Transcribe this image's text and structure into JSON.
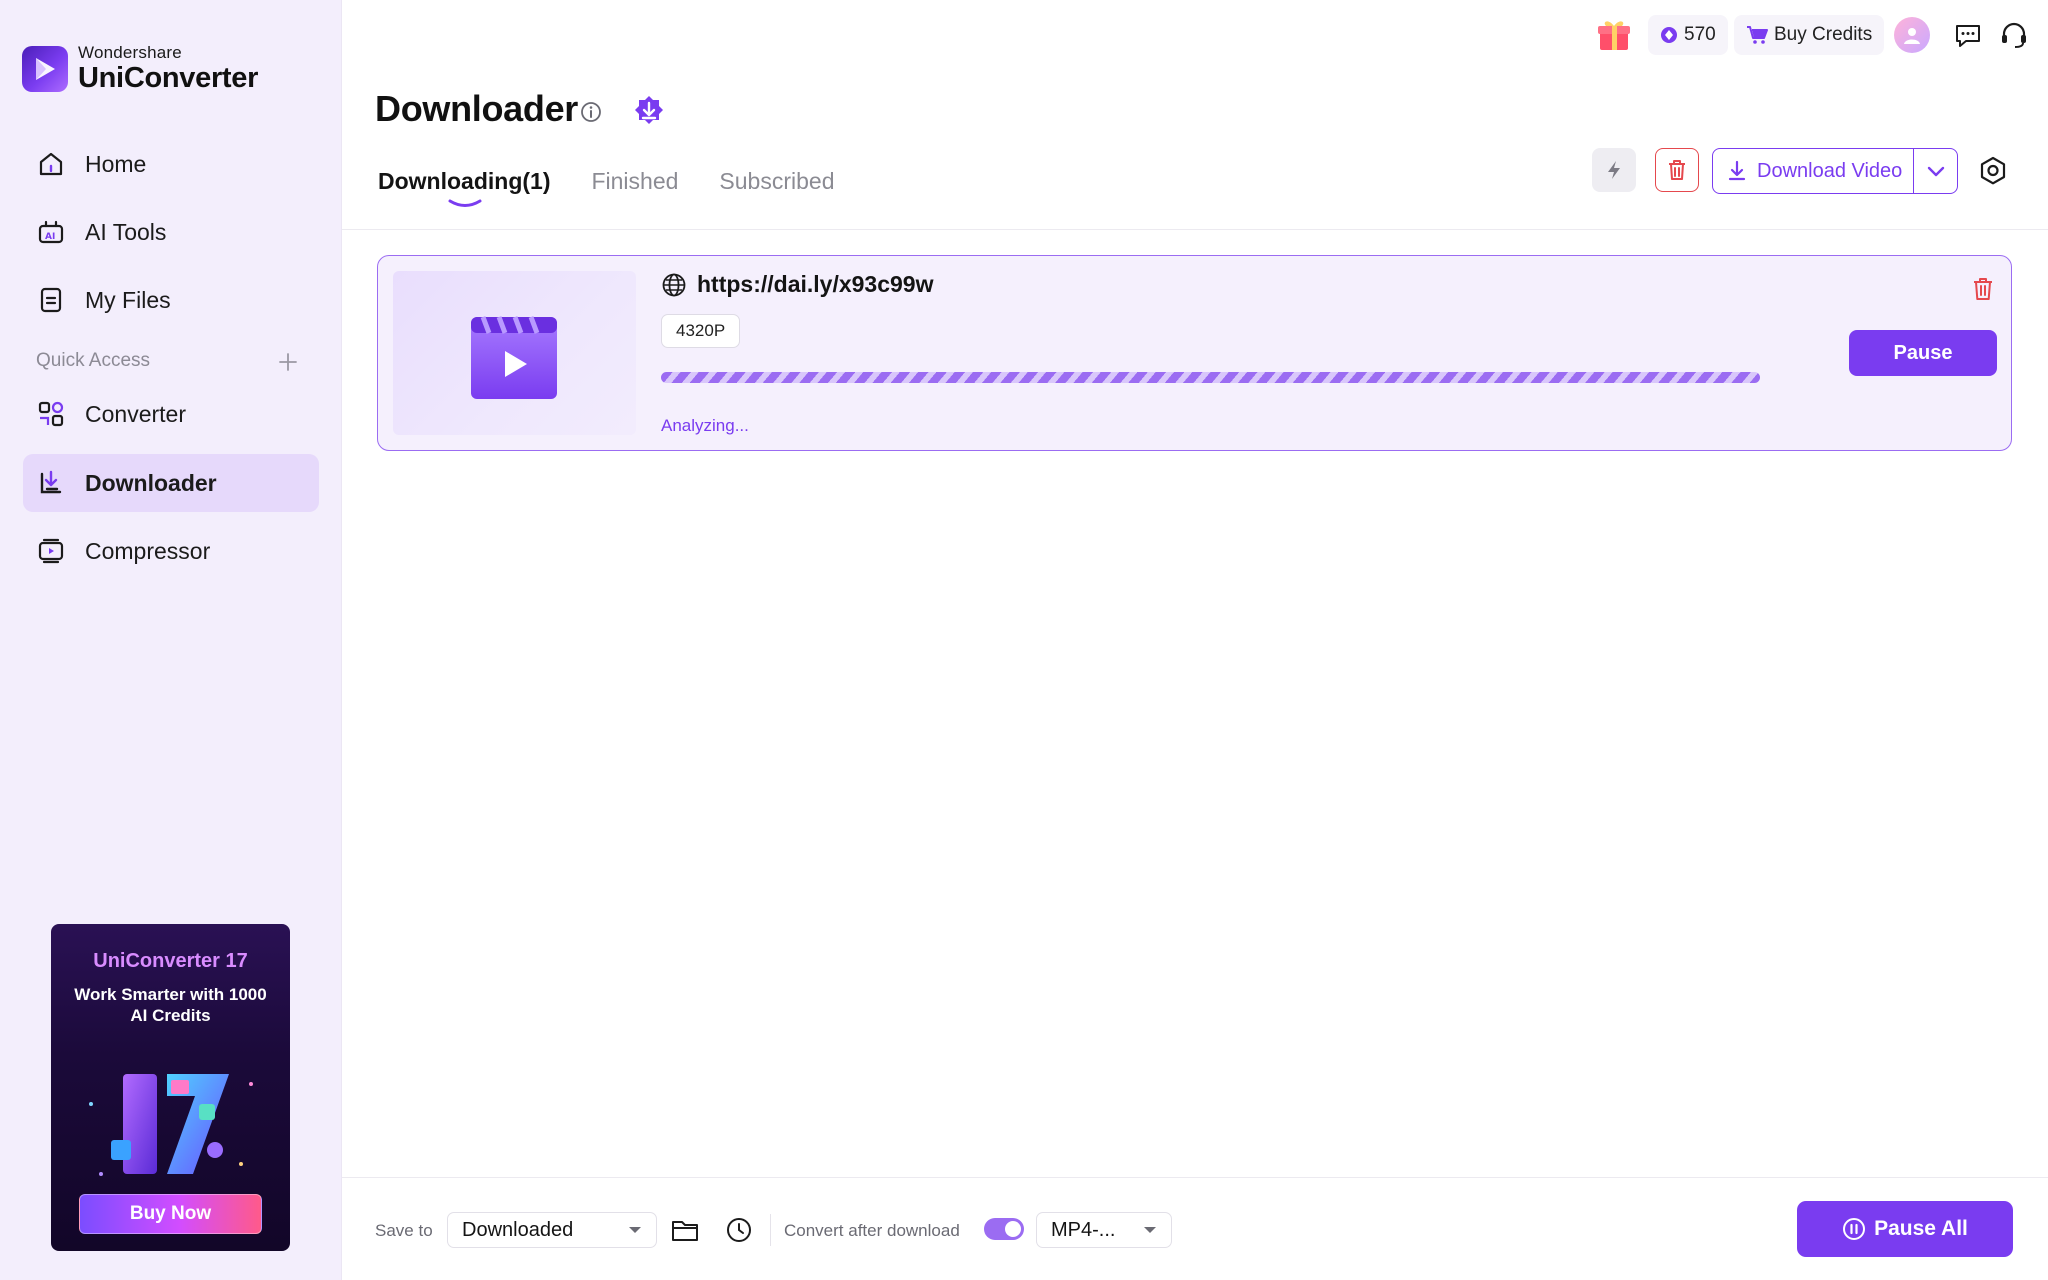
{
  "brand": {
    "small": "Wondershare",
    "big": "UniConverter"
  },
  "sidebar": {
    "items": [
      {
        "label": "Home",
        "icon": "home-icon"
      },
      {
        "label": "AI Tools",
        "icon": "ai-tools-icon"
      },
      {
        "label": "My Files",
        "icon": "my-files-icon"
      }
    ],
    "quick_access_label": "Quick Access",
    "quick_items": [
      {
        "label": "Converter",
        "icon": "converter-icon"
      },
      {
        "label": "Downloader",
        "icon": "downloader-icon",
        "active": true
      },
      {
        "label": "Compressor",
        "icon": "compressor-icon"
      }
    ]
  },
  "promo": {
    "title": "UniConverter 17",
    "subtitle": "Work Smarter with 1000 AI Credits",
    "button": "Buy Now"
  },
  "header": {
    "credits": "570",
    "buy_credits": "Buy Credits"
  },
  "page": {
    "title": "Downloader",
    "tabs": [
      {
        "label": "Downloading(1)",
        "active": true
      },
      {
        "label": "Finished"
      },
      {
        "label": "Subscribed"
      }
    ],
    "download_video": "Download Video"
  },
  "task": {
    "url": "https://dai.ly/x93c99w",
    "resolution": "4320P",
    "status": "Analyzing...",
    "pause": "Pause"
  },
  "bottom": {
    "save_to_label": "Save to",
    "save_to_value": "Downloaded",
    "convert_label": "Convert after download",
    "convert_enabled": true,
    "format_value": "MP4-...",
    "pause_all": "Pause All"
  },
  "colors": {
    "accent": "#7a3cf0",
    "accent_light": "#9b6cf2",
    "sidebar_bg": "#f3eefc",
    "active_bg": "#e6d9fb",
    "danger": "#e5484d"
  }
}
